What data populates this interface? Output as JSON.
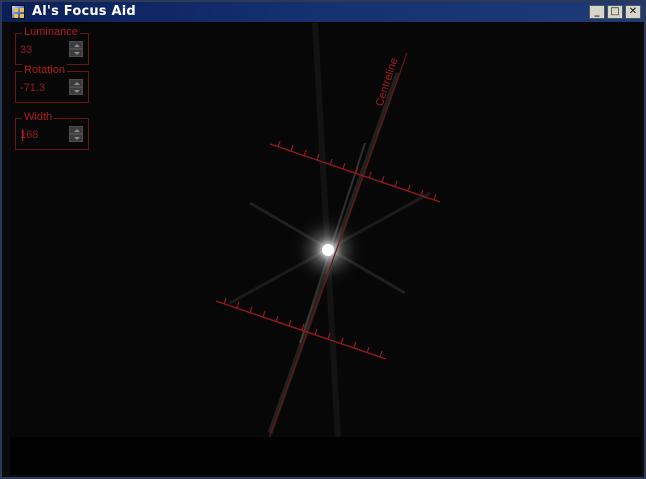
{
  "window": {
    "title": "Al's Focus Aid",
    "min_label": "_",
    "max_label": "□",
    "close_label": "✕"
  },
  "controls": {
    "luminance": {
      "label": "Luminance",
      "value": "33"
    },
    "rotation": {
      "label": "Rotation",
      "value": "-71.3"
    },
    "width": {
      "label": "Width",
      "value": "168"
    }
  },
  "overlay": {
    "centreline_label": "Centreline",
    "accent_color": "#9b1a1f"
  }
}
